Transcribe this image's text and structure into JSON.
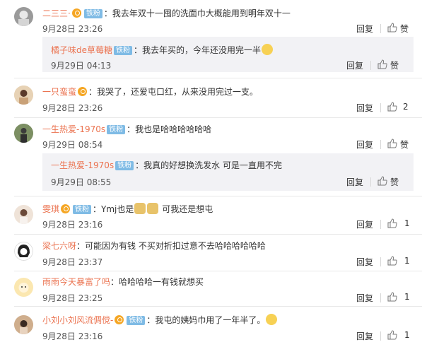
{
  "comments": [
    {
      "user": "二三三·",
      "badges": [
        "v",
        "fan"
      ],
      "badge_text": "铁粉",
      "text": "我去年双十一囤的洗面巾大概能用到明年双十一",
      "time": "9月28日 23:26",
      "reply": "回复",
      "likes": "赞"
    },
    {
      "user": "橘子味de草莓糖",
      "badges": [
        "fan"
      ],
      "badge_text": "铁粉",
      "text": "我去年买的，今年还没用完一半",
      "time": "9月29日 04:13",
      "reply": "回复",
      "likes": "赞"
    },
    {
      "user": "一只蛮蛮",
      "badges": [
        "v"
      ],
      "text": "我哭了，还爱屯口红，从来没用完过一支。",
      "time": "9月28日 23:26",
      "reply": "回复",
      "likes": "2"
    },
    {
      "user": "一生热爱-1970s",
      "badges": [
        "fan"
      ],
      "badge_text": "铁粉",
      "text": "我也是哈哈哈哈哈哈",
      "time": "9月29日 08:54",
      "reply": "回复",
      "likes": "赞"
    },
    {
      "user": "一生热爱-1970s",
      "badges": [
        "fan"
      ],
      "badge_text": "铁粉",
      "text": "我真的好想换洗发水 可是一直用不完",
      "time": "9月29日 08:55",
      "reply": "回复",
      "likes": "赞"
    },
    {
      "user": "雯琪",
      "badges": [
        "v",
        "fan"
      ],
      "badge_text": "铁粉",
      "text_before": "Ymj也是",
      "text_after": " 可我还是想屯",
      "time": "9月28日 23:16",
      "reply": "回复",
      "likes": "1"
    },
    {
      "user": "梁七六呀",
      "badges": [],
      "text": "可能因为有钱  不买对折扣过意不去哈哈哈哈哈哈",
      "time": "9月28日 23:37",
      "reply": "回复",
      "likes": "1"
    },
    {
      "user": "雨雨今天暴富了吗",
      "badges": [],
      "text": "哈哈哈哈一有钱就想买",
      "time": "9月28日 23:25",
      "reply": "回复",
      "likes": "1"
    },
    {
      "user": "小刘小刘风流倜傥-",
      "badges": [
        "v",
        "fan"
      ],
      "badge_text": "铁粉",
      "text": "我屯的姨妈巾用了一年半了。",
      "time": "9月28日 23:16",
      "reply": "回复",
      "likes": "1"
    }
  ],
  "colors": {
    "username": "#eb7350",
    "text": "#333333",
    "fan_badge": "#7fbbe5",
    "vip_badge": "#f5a623",
    "reply_bg": "#f2f2f5"
  }
}
